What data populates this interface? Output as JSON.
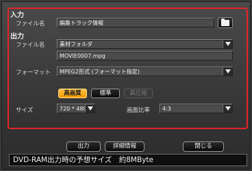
{
  "input": {
    "title": "入力",
    "file_label": "ファイル名",
    "file_value": "編集トラック情報"
  },
  "output": {
    "title": "出力",
    "file_label": "ファイル名",
    "folder_value": "素材フォルダ",
    "filename_value": "MOVIE0007.mpg",
    "format_label": "フォーマット",
    "format_value": "MPEG2形式 (フォーマット指定)"
  },
  "quality": {
    "high": "高画質",
    "standard": "標準",
    "high_compression": "高圧縮",
    "selected": "高画質"
  },
  "size": {
    "label": "サイズ",
    "value": "720 * 480"
  },
  "aspect": {
    "label": "画面比率",
    "value": "4:3"
  },
  "buttons": {
    "output": "出力",
    "details": "詳細情報",
    "close": "閉じる"
  },
  "status": {
    "text": "DVD-RAM出力時の予想サイズ　約8MByte"
  },
  "colors": {
    "highlight_border": "#e8232a",
    "active_quality": "#f7a21b"
  },
  "icons": {
    "folder": "folder-icon",
    "dropdown": "chevron-down-icon"
  }
}
